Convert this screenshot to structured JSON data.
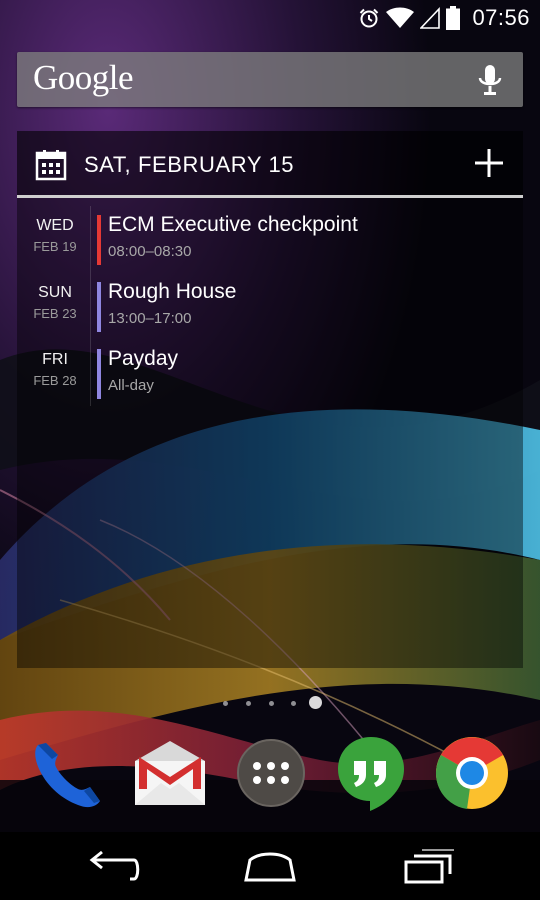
{
  "status_bar": {
    "time": "07:56",
    "icons": [
      "alarm-icon",
      "wifi-icon",
      "cell-signal-icon",
      "battery-icon"
    ]
  },
  "search_bar": {
    "logo_text": "Google",
    "mic_icon": "mic-icon"
  },
  "calendar_widget": {
    "header_date": "SAT, FEBRUARY 15",
    "header_icon": "calendar-icon",
    "add_icon": "plus-icon",
    "events": [
      {
        "day": "WED",
        "date": "FEB 19",
        "title": "ECM Executive checkpoint",
        "time": "08:00–08:30",
        "color": "#e53935"
      },
      {
        "day": "SUN",
        "date": "FEB 23",
        "title": "Rough House",
        "time": "13:00–17:00",
        "color": "#8f86e0"
      },
      {
        "day": "FRI",
        "date": "FEB 28",
        "title": "Payday",
        "time": "All-day",
        "color": "#8f86e0"
      }
    ]
  },
  "page_indicator": {
    "pages": 5,
    "current": 5
  },
  "dock": [
    {
      "name": "phone-icon",
      "label": "Phone"
    },
    {
      "name": "gmail-icon",
      "label": "Gmail"
    },
    {
      "name": "app-drawer-icon",
      "label": "Apps"
    },
    {
      "name": "hangouts-icon",
      "label": "Hangouts"
    },
    {
      "name": "chrome-icon",
      "label": "Chrome"
    }
  ],
  "nav_bar": {
    "buttons": [
      "back-icon",
      "home-icon",
      "recents-icon"
    ]
  },
  "colors": {
    "event_red": "#e53935",
    "event_purple": "#8f86e0",
    "hangouts_green": "#3aa33c",
    "phone_blue": "#1e63d8"
  }
}
